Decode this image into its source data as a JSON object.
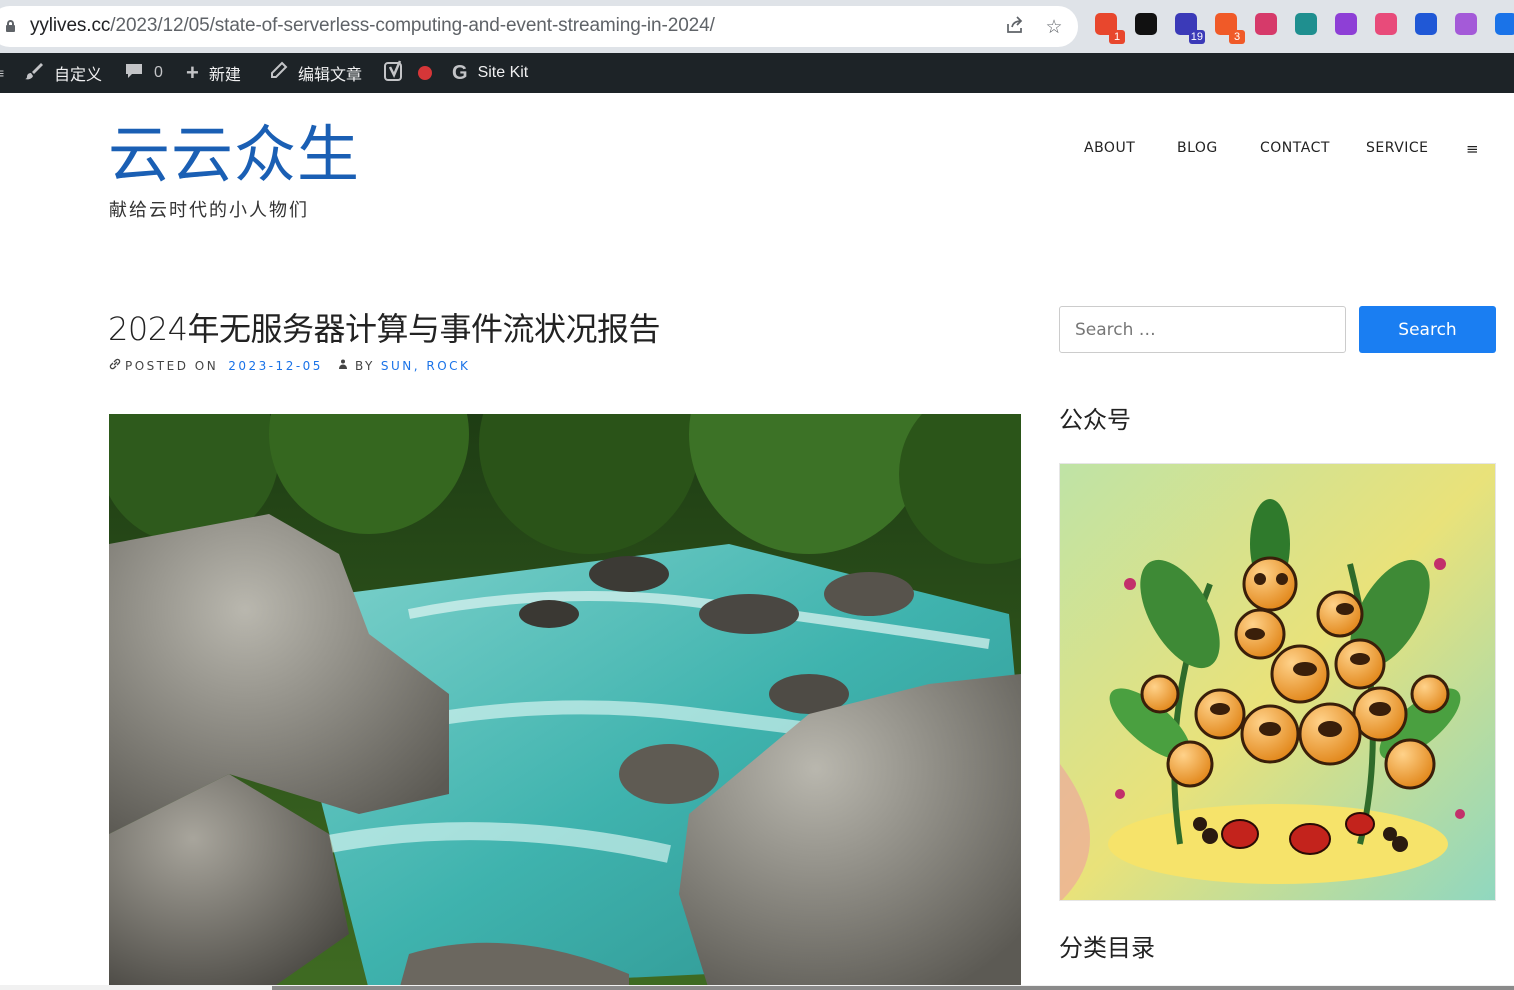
{
  "browser": {
    "url_domain": "yylives.cc",
    "url_path": "/2023/12/05/state-of-serverless-computing-and-event-streaming-in-2024/",
    "share_icon": "share-icon",
    "bookmark_icon": "star-icon",
    "extensions": [
      {
        "name": "chrome-ext-1",
        "badge": "1",
        "color": "#e8472d"
      },
      {
        "name": "notion",
        "badge": "",
        "color": "#111111"
      },
      {
        "name": "ext-graduation",
        "badge": "19",
        "color": "#3b3ab8"
      },
      {
        "name": "ext-chat",
        "badge": "3",
        "color": "#f05a28"
      },
      {
        "name": "ext-translate",
        "badge": "",
        "color": "#d63a6a"
      },
      {
        "name": "ext-grid",
        "badge": "",
        "color": "#1f8f8f"
      },
      {
        "name": "ext-lr",
        "badge": "",
        "color": "#8e3fd6"
      },
      {
        "name": "ext-cloud",
        "badge": "",
        "color": "#e84b7a"
      },
      {
        "name": "ext-cursor",
        "badge": "",
        "color": "#2058d6"
      },
      {
        "name": "ext-openai",
        "badge": "",
        "color": "#a45ad8"
      },
      {
        "name": "ext-sync",
        "badge": "",
        "color": "#1a73e8"
      }
    ]
  },
  "adminbar": {
    "customize": "自定义",
    "comments_count": "0",
    "new": "新建",
    "edit": "编辑文章",
    "sitekit": "Site Kit"
  },
  "site": {
    "title": "云云众生",
    "description": "献给云时代的小人物们",
    "nav": [
      "ABOUT",
      "BLOG",
      "CONTACT",
      "SERVICE"
    ],
    "menu_icon": "≡"
  },
  "post": {
    "title": "2024年无服务器计算与事件流状况报告",
    "posted_on_label": "POSTED ON",
    "date": "2023-12-05",
    "by_label": "BY",
    "author": "SUN, ROCK"
  },
  "sidebar": {
    "search_placeholder": "Search …",
    "search_button": "Search",
    "widget1_title": "公众号",
    "widget2_title": "分类目录"
  }
}
